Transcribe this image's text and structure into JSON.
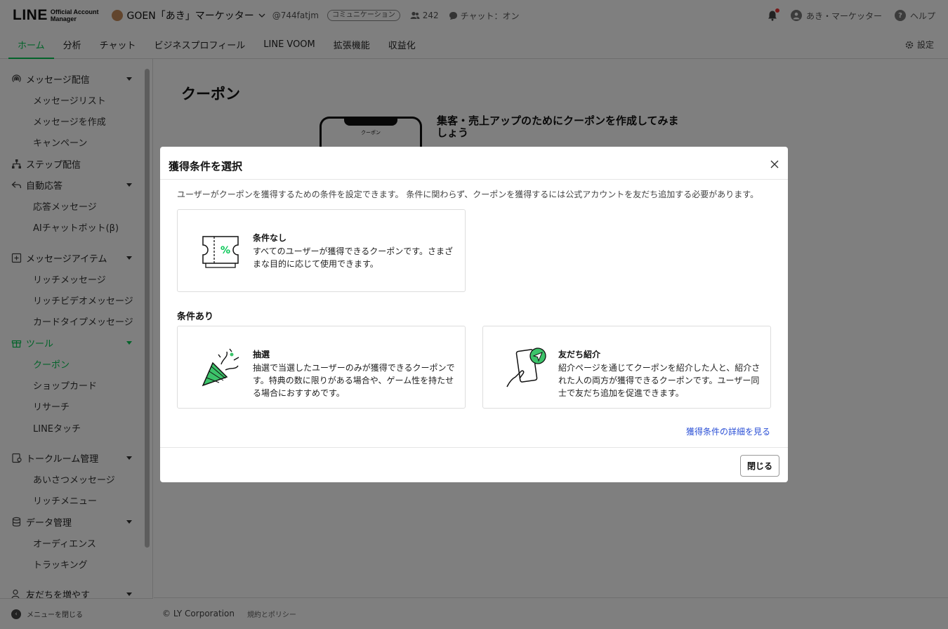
{
  "header": {
    "logo_main": "LINE",
    "logo_sub_1": "Official Account",
    "logo_sub_2": "Manager",
    "account_name": "GOEN「あき」マーケッター",
    "account_id": "@744fatjm",
    "plan_badge": "コミュニケーション",
    "friends_count": "242",
    "chat_status": "チャット：オン",
    "user_name": "あき・マーケッター",
    "help": "ヘルプ"
  },
  "nav": {
    "tabs": [
      {
        "label": "ホーム"
      },
      {
        "label": "分析"
      },
      {
        "label": "チャット"
      },
      {
        "label": "ビジネスプロフィール"
      },
      {
        "label": "LINE VOOM"
      },
      {
        "label": "拡張機能"
      },
      {
        "label": "収益化"
      }
    ],
    "settings": "設定"
  },
  "sidebar": {
    "groups": [
      {
        "label": "メッセージ配信"
      },
      {
        "label": "ステップ配信"
      },
      {
        "label": "自動応答"
      },
      {
        "label": "メッセージアイテム"
      },
      {
        "label": "ツール"
      },
      {
        "label": "トークルーム管理"
      },
      {
        "label": "データ管理"
      },
      {
        "label": "友だちを増やす"
      }
    ],
    "items": [
      {
        "label": "メッセージリスト"
      },
      {
        "label": "メッセージを作成"
      },
      {
        "label": "キャンペーン"
      },
      {
        "label": "応答メッセージ"
      },
      {
        "label": "AIチャットボット(β)"
      },
      {
        "label": "リッチメッセージ"
      },
      {
        "label": "リッチビデオメッセージ"
      },
      {
        "label": "カードタイプメッセージ"
      },
      {
        "label": "クーポン"
      },
      {
        "label": "ショップカード"
      },
      {
        "label": "リサーチ"
      },
      {
        "label": "LINEタッチ"
      },
      {
        "label": "あいさつメッセージ"
      },
      {
        "label": "リッチメニュー"
      },
      {
        "label": "オーディエンス"
      },
      {
        "label": "トラッキング"
      }
    ],
    "footer": "メニューを閉じる"
  },
  "main": {
    "title": "クーポン",
    "phone_header": "クーポン",
    "heading": "集客・売上アップのためにクーポンを作成してみましょう"
  },
  "footer": {
    "copyright": "© LY Corporation",
    "policy": "規約とポリシー"
  },
  "modal": {
    "title": "獲得条件を選択",
    "description": "ユーザーがクーポンを獲得するための条件を設定できます。 条件に関わらず、クーポンを獲得するには公式アカウントを友だち追加する必要があります。",
    "no_condition": {
      "title": "条件なし",
      "text": "すべてのユーザーが獲得できるクーポンです。さまざまな目的に応じて使用できます。"
    },
    "with_condition_label": "条件あり",
    "lottery": {
      "title": "抽選",
      "text": "抽選で当選したユーザーのみが獲得できるクーポンです。特典の数に限りがある場合や、ゲーム性を持たせる場合におすすめです。"
    },
    "referral": {
      "title": "友だち紹介",
      "text": "紹介ページを通じてクーポンを紹介した人と、紹介された人の両方が獲得できるクーポンです。ユーザー同士で友だち追加を促進できます。"
    },
    "details_link": "獲得条件の詳細を見る",
    "close_button": "閉じる"
  },
  "colors": {
    "accent": "#06c755",
    "link": "#2a4fd6",
    "notification_dot": "#e33333"
  }
}
